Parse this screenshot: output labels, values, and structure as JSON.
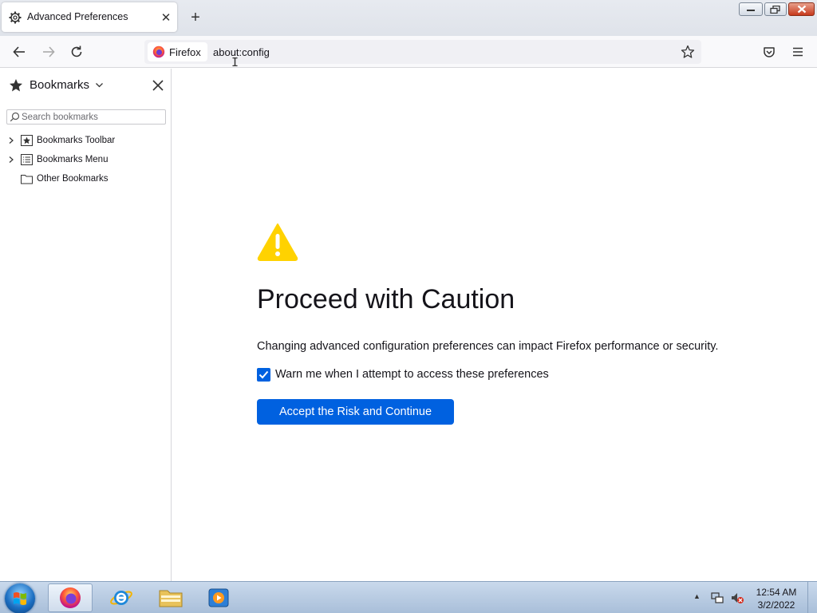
{
  "tab": {
    "title": "Advanced Preferences",
    "icon": "gear-icon"
  },
  "urlbar": {
    "identity_label": "Firefox",
    "url": "about:config"
  },
  "sidebar": {
    "title": "Bookmarks",
    "search_placeholder": "Search bookmarks",
    "items": [
      {
        "label": "Bookmarks Toolbar",
        "icon": "bookmarks-toolbar-icon",
        "expandable": true
      },
      {
        "label": "Bookmarks Menu",
        "icon": "bookmarks-menu-icon",
        "expandable": true
      },
      {
        "label": "Other Bookmarks",
        "icon": "folder-icon",
        "expandable": false
      }
    ]
  },
  "content": {
    "heading": "Proceed with Caution",
    "description": "Changing advanced configuration preferences can impact Firefox performance or security.",
    "checkbox_label": "Warn me when I attempt to access these preferences",
    "checkbox_checked": true,
    "accept_button": "Accept the Risk and Continue"
  },
  "taskbar": {
    "clock_time": "12:54 AM",
    "clock_date": "3/2/2022",
    "pinned": [
      "firefox-icon",
      "internet-explorer-icon",
      "file-explorer-icon",
      "media-player-icon"
    ]
  },
  "colors": {
    "accent": "#0061e0",
    "warning": "#ffd200"
  }
}
